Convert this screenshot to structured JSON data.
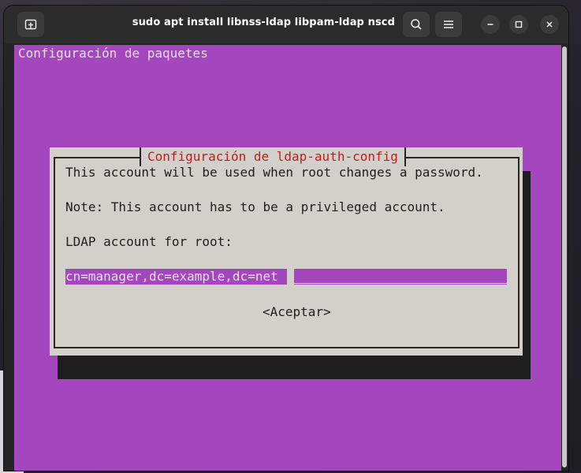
{
  "window": {
    "title": "sudo apt install libnss-ldap libpam-ldap nscd",
    "new_tab_icon": "new-tab-icon",
    "search_icon": "search-icon",
    "menu_icon": "hamburger-menu-icon",
    "minimize_icon": "minimize-icon",
    "maximize_icon": "maximize-icon",
    "close_icon": "close-icon"
  },
  "terminal": {
    "background_color": "#a447be",
    "heading": "Configuración de paquetes"
  },
  "dialog": {
    "title": "Configuración de ldap-auth-config",
    "line1": "This account will be used when root changes a password.",
    "line2": "Note: This account has to be a privileged account.",
    "line3": "LDAP account for root:",
    "input_value": "cn=manager,dc=example,dc=net",
    "ok_button": "<Aceptar>",
    "title_color": "#c11d1d"
  }
}
